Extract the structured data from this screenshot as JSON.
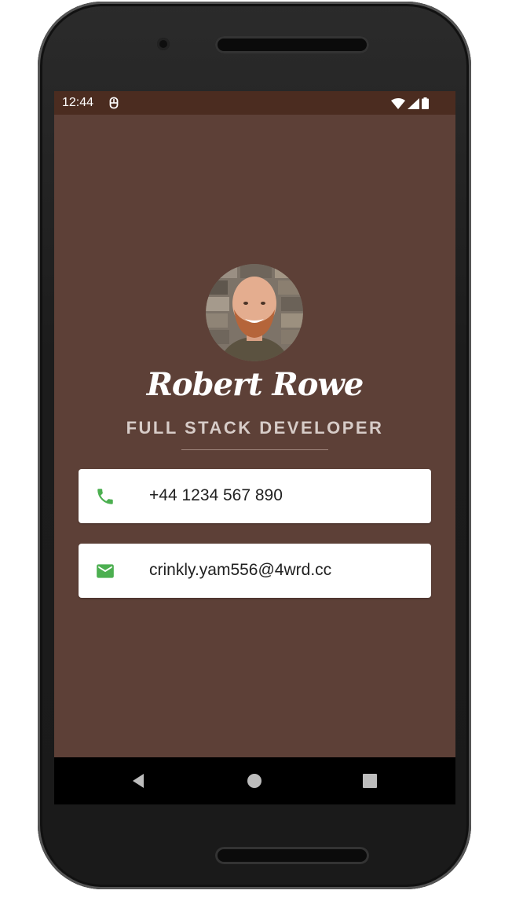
{
  "status_bar": {
    "time": "12:44"
  },
  "profile": {
    "name": "Robert Rowe",
    "title": "FULL STACK DEVELOPER"
  },
  "contacts": {
    "phone": "+44 1234 567 890",
    "email": "crinkly.yam556@4wrd.cc"
  },
  "colors": {
    "background": "#5d4037",
    "status_bar": "#4b2c20",
    "icon_accent": "#4caf50",
    "card": "#ffffff"
  },
  "icons": {
    "phone": "phone-icon",
    "email": "email-icon",
    "back": "back-icon",
    "home": "home-icon",
    "recents": "recents-icon"
  }
}
